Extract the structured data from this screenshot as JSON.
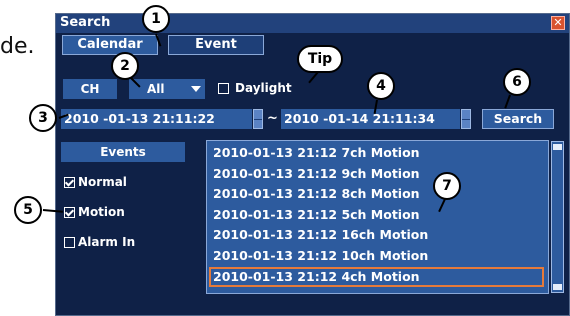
{
  "background": {
    "partial_text": "de."
  },
  "dialog": {
    "title": "Search",
    "close_glyph": "✕",
    "tabs": [
      {
        "label": "Calendar",
        "active": true
      },
      {
        "label": "Event",
        "active": false
      }
    ],
    "ch_label": "CH",
    "channel_select": {
      "value": "All"
    },
    "daylight": {
      "label": "Daylight",
      "checked": false
    },
    "start_datetime": "2010 -01-13  21:11:22",
    "range_separator": "~",
    "end_datetime": "2010 -01-14  21:11:34",
    "search_label": "Search",
    "events_header": "Events",
    "event_filters": [
      {
        "label": "Normal",
        "checked": true
      },
      {
        "label": "Motion",
        "checked": true
      },
      {
        "label": "Alarm In",
        "checked": false
      }
    ],
    "results": [
      "2010-01-13 21:12 7ch Motion",
      "2010-01-13 21:12 9ch Motion",
      "2010-01-13 21:12 8ch Motion",
      "2010-01-13 21:12 5ch Motion",
      "2010-01-13 21:12 16ch Motion",
      "2010-01-13 21:12 10ch Motion",
      "2010-01-13 21:12 4ch Motion"
    ],
    "selected_result_index": 6
  },
  "callouts": [
    "1",
    "2",
    "Tip",
    "3",
    "4",
    "5",
    "6",
    "7"
  ],
  "colors": {
    "dialog_bg": "#0f2147",
    "field_bg": "#2d5b9e",
    "selection_border": "#e57a3a",
    "close_button": "#d9532f"
  }
}
